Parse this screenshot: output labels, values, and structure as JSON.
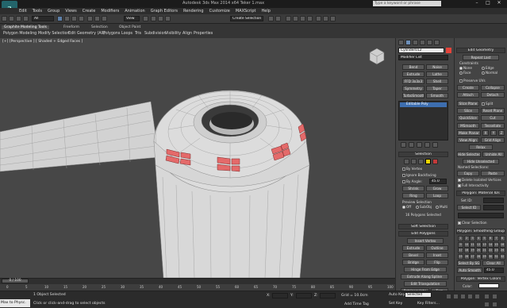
{
  "window": {
    "title": "Autodesk 3ds Max 2014 x64     Teker 1.max",
    "search_placeholder": "Type a keyword or phrase",
    "logo": "3"
  },
  "menu": [
    "Edit",
    "Tools",
    "Group",
    "Views",
    "Create",
    "Modifiers",
    "Animation",
    "Graph Editors",
    "Rendering",
    "Customize",
    "MAXScript",
    "Help"
  ],
  "toolbar": {
    "selection_filter": "All",
    "view_dropdown": "View",
    "named_selection": "Create Selection Se"
  },
  "ribbon": {
    "tabs": [
      "Graphite Modeling Tools",
      "Freeform",
      "Selection",
      "Object Paint"
    ],
    "sub": [
      "Polygon Modeling",
      "Modify Selection",
      "Edit",
      "Geometry (All)",
      "Polygons",
      "Loops",
      "Tris",
      "Subdivision",
      "Visibility",
      "Align",
      "Properties"
    ]
  },
  "viewport": {
    "label": "[+] [Perspective ] [ Shaded + Edged Faces ]",
    "colors": {
      "bg": "#474747",
      "mesh": "#d7d7d7",
      "selected": "#e46a6a",
      "wire": "#8c8c8c"
    }
  },
  "modify": {
    "object_name": "Cylinder012",
    "modifier_list": "Modifier List",
    "buttons": [
      [
        "Bend",
        "Noise"
      ],
      [
        "Extrude",
        "Lathe"
      ],
      [
        "FFD 3x3x3",
        "Shell"
      ],
      [
        "Symmetry",
        "Taper"
      ],
      [
        "TurboSmooth",
        "Smooth"
      ]
    ],
    "stack_item": "Editable Poly"
  },
  "selection": {
    "title": "Selection",
    "by_vertex": "By Vertex",
    "ignore_backfacing": "Ignore Backfacing",
    "by_angle": "By Angle:",
    "angle": "45.0",
    "shrink": "Shrink",
    "grow": "Grow",
    "ring": "Ring",
    "loop": "Loop",
    "preview": "Preview Selection",
    "off": "Off",
    "subobj": "SubObj",
    "multi": "Multi",
    "count": "16 Polygons Selected"
  },
  "soft_selection": {
    "title": "Soft Selection"
  },
  "edit_polygons": {
    "title": "Edit Polygons",
    "insert_vertex": "Insert Vertex",
    "rows": [
      [
        "Extrude",
        "Outline"
      ],
      [
        "Bevel",
        "Inset"
      ],
      [
        "Bridge",
        "Flip"
      ]
    ],
    "hinge": "Hinge From Edge",
    "extrude_spline": "Extrude Along Spline",
    "edit_tri": "Edit Triangulation",
    "retri": "Retriangulate",
    "turn": "Turn"
  },
  "edit_geometry": {
    "title": "Edit Geometry",
    "repeat": "Repeat Last",
    "constraints": "Constraints",
    "none": "None",
    "edge": "Edge",
    "face": "Face",
    "normal": "Normal",
    "preserve": "Preserve UVs",
    "create": "Create",
    "collapse": "Collapse",
    "attach": "Attach",
    "detach": "Detach",
    "slice_plane": "Slice Plane",
    "split": "Split",
    "slice": "Slice",
    "reset_plane": "Reset Plane",
    "quickslice": "QuickSlice",
    "cut": "Cut",
    "msmooth": "MSmooth",
    "tessellate": "Tessellate",
    "make_planar": "Make Planar",
    "x": "X",
    "y": "Y",
    "z": "Z",
    "view_align": "View Align",
    "grid_align": "Grid Align",
    "relax": "Relax",
    "hide_sel": "Hide Selected",
    "unhide_all": "Unhide All",
    "hide_unsel": "Hide Unselected",
    "named_sel": "Named Selections:",
    "copy": "Copy",
    "paste": "Paste",
    "delete_iso": "Delete Isolated Vertices",
    "full_inter": "Full Interactivity"
  },
  "material_ids": {
    "title": "Polygon: Material IDs",
    "set_id": "Set ID:",
    "select_id": "Select ID",
    "clear": "Clear Selection"
  },
  "smoothing": {
    "title": "Polygon: Smoothing Groups",
    "groups": [
      "1",
      "2",
      "3",
      "4",
      "5",
      "6",
      "7",
      "8",
      "9",
      "10",
      "11",
      "12",
      "13",
      "14",
      "15",
      "16",
      "17",
      "18",
      "19",
      "20",
      "21",
      "22",
      "23",
      "24",
      "25",
      "26",
      "27",
      "28",
      "29",
      "30",
      "31",
      "32"
    ],
    "select_by": "Select By SG",
    "clear_all": "Clear All",
    "auto": "Auto Smooth",
    "auto_val": "45.0"
  },
  "vertex_colors": {
    "title": "Polygon: Vertex Colors",
    "color": "Color:"
  },
  "timeline": {
    "frame": "0 / 100",
    "ticks": [
      "0",
      "5",
      "10",
      "15",
      "20",
      "25",
      "30",
      "35",
      "40",
      "45",
      "50",
      "55",
      "60",
      "65",
      "70",
      "75",
      "80",
      "85",
      "90",
      "95",
      "100"
    ]
  },
  "status": {
    "maxscript": "Max to Physc.",
    "selected": "1 Object Selected",
    "prompt": "Click or click-and-drag to select objects",
    "x": "X:",
    "y": "Y:",
    "z": "Z:",
    "grid": "Grid = 10.0cm",
    "add_time_tag": "Add Time Tag",
    "auto_key": "Auto Key",
    "selected_mode": "Selected",
    "set_key": "Set Key",
    "key_filters": "Key Filters..."
  }
}
